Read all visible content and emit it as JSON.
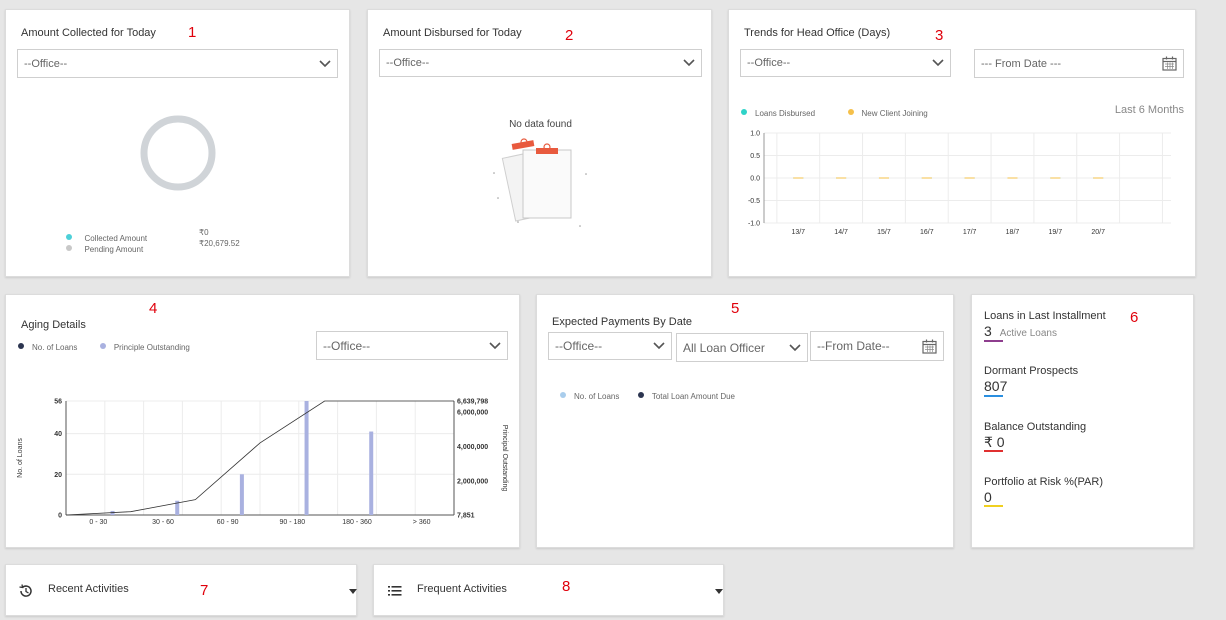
{
  "cards": {
    "collected": {
      "title": "Amount Collected for Today",
      "number": "1",
      "office_select": "--Office--",
      "legend": [
        {
          "label": "Collected Amount",
          "value": "₹0",
          "color": "#4dd0d8"
        },
        {
          "label": "Pending Amount",
          "value": "₹20,679.52",
          "color": "#c8c8c8"
        }
      ],
      "ring_color": "#d0d4d8"
    },
    "disbursed": {
      "title": "Amount Disbursed for Today",
      "number": "2",
      "office_select": "--Office--",
      "empty_message": "No data found"
    },
    "trends": {
      "title": "Trends for Head Office (Days)",
      "number": "3",
      "office_select": "--Office--",
      "from_date_placeholder": "--- From Date ---",
      "period": "Last 6 Months",
      "legend": [
        {
          "label": "Loans Disbursed",
          "color": "#2ed3c8"
        },
        {
          "label": "New Client Joining",
          "color": "#f5c04a"
        }
      ]
    },
    "aging": {
      "title": "Aging Details",
      "number": "4",
      "office_select": "--Office--",
      "legend": [
        {
          "label": "No. of Loans",
          "color": "#2c3550"
        },
        {
          "label": "Principle Outstanding",
          "color": "#a9b1e0"
        }
      ]
    },
    "expected": {
      "title": "Expected Payments By Date",
      "number": "5",
      "office_select": "--Office--",
      "loan_officer_select": "All Loan Officer",
      "from_date_placeholder": "--From Date--",
      "legend": [
        {
          "label": "No. of Loans",
          "color": "#a9cdec"
        },
        {
          "label": "Total Loan Amount Due",
          "color": "#2c3550"
        }
      ]
    },
    "metrics": {
      "number": "6",
      "items": [
        {
          "label": "Loans in Last Installment",
          "value": "3",
          "sub": "Active Loans",
          "color": "#8e3e8e"
        },
        {
          "label": "Dormant Prospects",
          "value": "807",
          "sub": "",
          "color": "#2a8fe0"
        },
        {
          "label": "Balance Outstanding",
          "value": "₹ 0",
          "sub": "",
          "color": "#e03030"
        },
        {
          "label": "Portfolio at Risk %(PAR)",
          "value": "0",
          "sub": "",
          "color": "#f0d020"
        }
      ]
    },
    "recent": {
      "title": "Recent Activities",
      "number": "7"
    },
    "frequent": {
      "title": "Frequent Activities",
      "number": "8"
    }
  },
  "chart_data": [
    {
      "type": "line",
      "title": "Trends for Head Office (Days)",
      "categories": [
        "13/7",
        "14/7",
        "15/7",
        "16/7",
        "17/7",
        "18/7",
        "19/7",
        "20/7"
      ],
      "series": [
        {
          "name": "Loans Disbursed",
          "values": [
            0,
            0,
            0,
            0,
            0,
            0,
            0,
            0
          ]
        },
        {
          "name": "New Client Joining",
          "values": [
            0,
            0,
            0,
            0,
            0,
            0,
            0,
            0
          ]
        }
      ],
      "y_ticks": [
        "1.0",
        "0.5",
        "0.0",
        "-0.5",
        "-1.0"
      ],
      "ylim": [
        -1,
        1
      ]
    },
    {
      "type": "bar",
      "title": "Aging Details",
      "categories": [
        "0 - 30",
        "30 - 60",
        "60 - 90",
        "90 - 180",
        "180 - 360",
        "> 360"
      ],
      "series": [
        {
          "name": "No. of Loans",
          "type": "bar",
          "axis": "left",
          "values": [
            2,
            7,
            20,
            56,
            41,
            0
          ]
        },
        {
          "name": "Principle Outstanding",
          "type": "line",
          "axis": "right",
          "values": [
            7851,
            200000,
            900000,
            4200000,
            6639798,
            6639798
          ]
        }
      ],
      "ylabel": "No. of Loans",
      "ylabel_right": "Principal Outstanding",
      "y_ticks": [
        "0",
        "20",
        "40",
        "56"
      ],
      "y_right_ticks": [
        "7,851",
        "2,000,000",
        "4,000,000",
        "6,000,000",
        "6,639,798"
      ],
      "ylim": [
        0,
        56
      ],
      "ylim_right": [
        7851,
        6639798
      ]
    }
  ]
}
